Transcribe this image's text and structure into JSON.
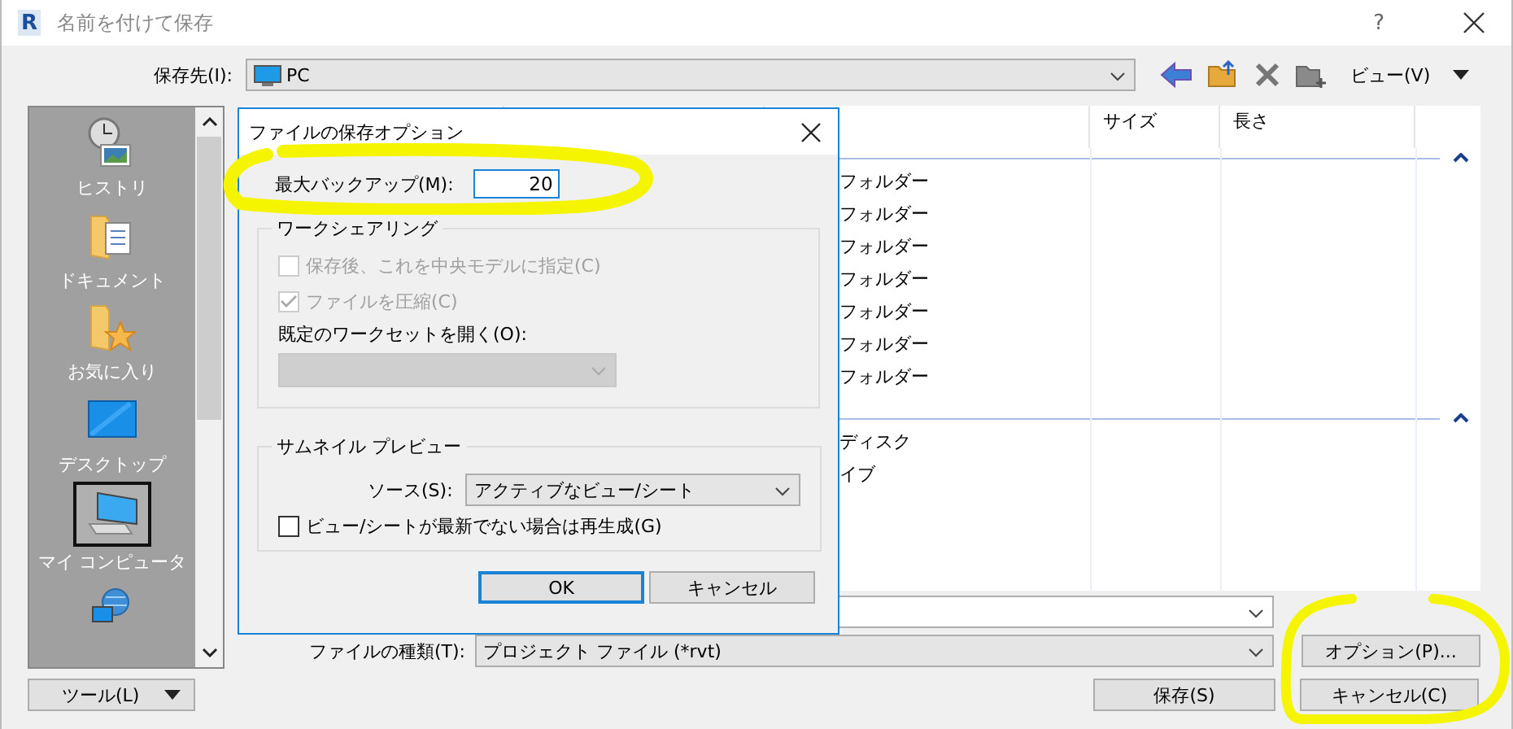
{
  "window": {
    "logo": "R",
    "title": "名前を付けて保存",
    "help": "?"
  },
  "save_in": {
    "label": "保存先(I):",
    "value": "PC"
  },
  "toolbar": {
    "view_menu": "ビュー(V)"
  },
  "places": [
    {
      "kind": "history",
      "label": "ヒストリ",
      "selected": false
    },
    {
      "kind": "documents",
      "label": "ドキュメント",
      "selected": false
    },
    {
      "kind": "favorites",
      "label": "お気に入り",
      "selected": false
    },
    {
      "kind": "desktop",
      "label": "デスクトップ",
      "selected": false
    },
    {
      "kind": "computer",
      "label": "マイ コンピュータ",
      "selected": true
    },
    {
      "kind": "network",
      "selected": false
    }
  ],
  "file_list": {
    "columns": [
      "サイズ",
      "長さ"
    ],
    "groups": [
      {
        "rows": [
          "フォルダー",
          "フォルダー",
          "フォルダー",
          "フォルダー",
          "フォルダー",
          "フォルダー",
          "フォルダー"
        ]
      },
      {
        "rows": [
          "ディスク",
          "イブ"
        ]
      }
    ]
  },
  "file_type": {
    "label": "ファイルの種類(T):",
    "value": "プロジェクト ファイル (*rvt)"
  },
  "buttons": {
    "options": "オプション(P)...",
    "tools": "ツール(L)",
    "save": "保存(S)",
    "cancel": "キャンセル(C)"
  },
  "dialog": {
    "title": "ファイルの保存オプション",
    "max_backup": {
      "label": "最大バックアップ(M):",
      "value": "20"
    },
    "worksharing": {
      "title": "ワークシェアリング",
      "checkboxes": [
        {
          "label": "保存後、これを中央モデルに指定(C)",
          "checked": false,
          "disabled": true
        },
        {
          "label": "ファイルを圧縮(C)",
          "checked": true,
          "disabled": true
        }
      ],
      "workset_label": "既定のワークセットを開く(O):",
      "workset_disabled": true
    },
    "thumbnail": {
      "title": "サムネイル プレビュー",
      "source_label": "ソース(S):",
      "source_value": "アクティブなビュー/シート",
      "regenerate": {
        "label": "ビュー/シートが最新でない場合は再生成(G)",
        "checked": false
      }
    },
    "ok": "OK",
    "cancel": "キャンセル"
  }
}
